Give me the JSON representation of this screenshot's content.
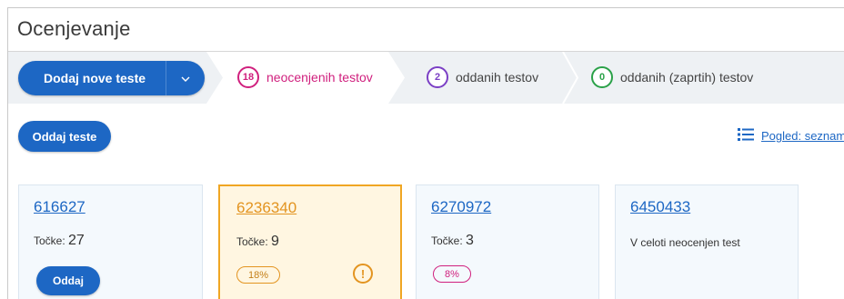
{
  "page": {
    "title": "Ocenjevanje"
  },
  "toolbar": {
    "add_tests_label": "Dodaj nove teste"
  },
  "steps": [
    {
      "count": "18",
      "label": "neocenjenih testov",
      "color": "#d0207e"
    },
    {
      "count": "2",
      "label": "oddanih testov",
      "color": "#7b3fc5"
    },
    {
      "count": "0",
      "label": "oddanih (zaprtih) testov",
      "color": "#2aa148"
    }
  ],
  "actions": {
    "submit_tests_label": "Oddaj teste",
    "view_label": "Pogled: seznam"
  },
  "cards": [
    {
      "id": "616627",
      "points_label": "Točke:",
      "points": "27",
      "button_label": "Oddaj"
    },
    {
      "id": "6236340",
      "points_label": "Točke:",
      "points": "9",
      "percent": "18%",
      "status_color": "#e39420"
    },
    {
      "id": "6270972",
      "points_label": "Točke:",
      "points": "3",
      "percent": "8%",
      "status_color": "#d0207e"
    },
    {
      "id": "6450433",
      "note": "V celoti neocenjen test"
    }
  ],
  "colors": {
    "accent": "#1d67c4",
    "warning": "#e39420"
  }
}
